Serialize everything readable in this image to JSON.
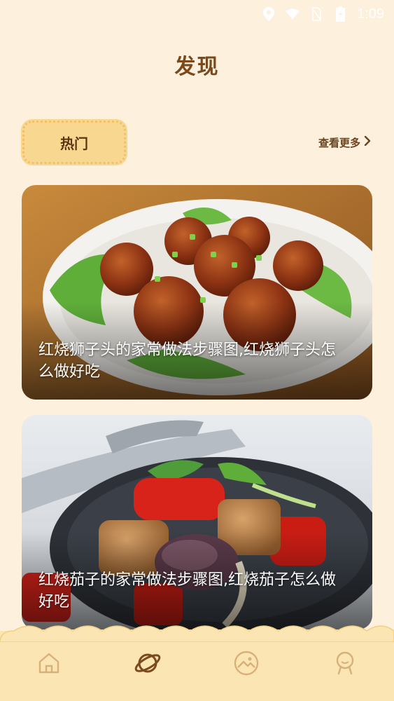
{
  "status_bar": {
    "time": "1:09",
    "icons": [
      "location-icon",
      "wifi-icon",
      "no-sim-icon",
      "battery-icon"
    ]
  },
  "page": {
    "title": "发现"
  },
  "section": {
    "tag_label": "热门",
    "see_more_label": "查看更多",
    "see_more_icon": "chevron-right-icon"
  },
  "cards": [
    {
      "caption": "红烧狮子头的家常做法步骤图,红烧狮子头怎么做好吃",
      "image": "braised-meatballs-photo"
    },
    {
      "caption": "红烧茄子的家常做法步骤图,红烧茄子怎么做好吃",
      "image": "braised-eggplant-photo"
    }
  ],
  "tabbar": {
    "tabs": [
      {
        "name": "home",
        "icon": "home-icon",
        "active": false
      },
      {
        "name": "discover",
        "icon": "planet-icon",
        "active": true
      },
      {
        "name": "gallery",
        "icon": "image-icon",
        "active": false
      },
      {
        "name": "profile",
        "icon": "person-icon",
        "active": false
      }
    ]
  },
  "colors": {
    "background": "#fdf0dc",
    "accent": "#f8d890",
    "text_brown": "#6b4420",
    "tabbar": "#fbe5b2"
  }
}
